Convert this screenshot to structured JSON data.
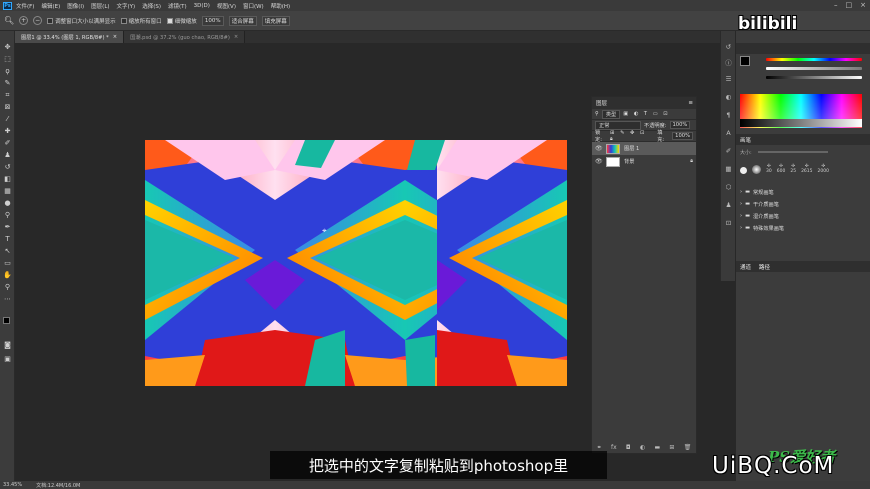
{
  "menu": {
    "app_icon": "Ps",
    "items": [
      "文件(F)",
      "编辑(E)",
      "图像(I)",
      "图层(L)",
      "文字(Y)",
      "选择(S)",
      "滤镜(T)",
      "3D(D)",
      "视图(V)",
      "窗口(W)",
      "帮助(H)"
    ]
  },
  "options": {
    "chk1": "调整窗口大小以满屏显示",
    "chk2": "缩放所有窗口",
    "chk3": "细微缩放",
    "zoom": "100%",
    "btn_fit": "适合屏幕",
    "btn_fill": "填充屏幕"
  },
  "tabs": [
    {
      "label": "图层1 @ 33.4% (图层 1, RGB/8#) *",
      "active": true
    },
    {
      "label": "国潮.psd @ 37.2% (guo chao, RGB/8#)",
      "active": false
    }
  ],
  "layers_panel": {
    "title": "图层",
    "kind": "类型",
    "blend": "正常",
    "opacity_label": "不透明度:",
    "opacity": "100%",
    "lock_label": "锁定:",
    "fill_label": "填充:",
    "fill": "100%",
    "layers": [
      {
        "name": "图层 1",
        "selected": true
      },
      {
        "name": "背景",
        "selected": false
      }
    ]
  },
  "color_panel": {
    "fg": "#000000",
    "bg": "#ffffff"
  },
  "brush_panel": {
    "title": "画笔",
    "size_label": "大小:",
    "presets": [
      "30",
      "600",
      "25",
      "2615",
      "2000"
    ],
    "groups": [
      "常规画笔",
      "干介质画笔",
      "湿介质画笔",
      "特殊效果画笔"
    ]
  },
  "bottom_tabs": [
    "通道",
    "路径"
  ],
  "status": {
    "zoom": "33.45%",
    "doc": "文档:12.4M/16.0M"
  },
  "subtitle": "把选中的文字复制粘贴到photoshop里",
  "watermarks": {
    "bili": "bilibili",
    "uibq": "UiBQ.CoM",
    "psak": "PS爱好者"
  }
}
